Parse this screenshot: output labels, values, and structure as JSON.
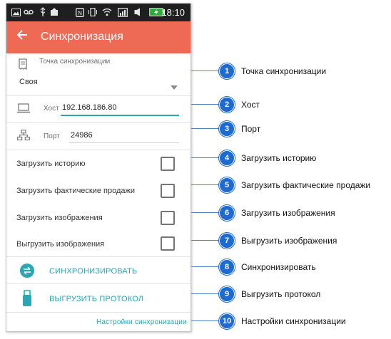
{
  "statusbar": {
    "time": "18:10",
    "icons": [
      "image-icon",
      "voicemail-icon",
      "usb-icon",
      "upload-icon",
      "nfc-icon",
      "vibrate-icon",
      "wifi-icon",
      "signal-icon",
      "battery-icon"
    ]
  },
  "appbar": {
    "back_icon": "arrow-left-icon",
    "title": "Синхронизация"
  },
  "sync_point": {
    "label": "Точка синхронизации",
    "value": "Своя"
  },
  "host": {
    "label": "Хост",
    "value": "192.168.186.80"
  },
  "port": {
    "label": "Порт",
    "value": "24986"
  },
  "checkboxes": [
    {
      "label": "Загрузить историю",
      "checked": false
    },
    {
      "label": "Загрузить фактические продажи",
      "checked": false
    },
    {
      "label": "Загрузить изображения",
      "checked": false
    },
    {
      "label": "Выгрузить изображения",
      "checked": false
    }
  ],
  "actions": {
    "sync": "СИНХРОНИЗИРОВАТЬ",
    "upload_protocol": "ВЫГРУЗИТЬ ПРОТОКОЛ",
    "settings_link": "Настройки синхронизации"
  },
  "colors": {
    "appbar": "#ee6a55",
    "accent": "#2aa6b4",
    "callout": "#1d6bd0"
  },
  "callouts": [
    {
      "num": "1",
      "text": "Точка синхронизации"
    },
    {
      "num": "2",
      "text": "Хост"
    },
    {
      "num": "3",
      "text": "Порт"
    },
    {
      "num": "4",
      "text": "Загрузить историю"
    },
    {
      "num": "5",
      "text": "Загрузить фактические продажи"
    },
    {
      "num": "6",
      "text": "Загрузить изображения"
    },
    {
      "num": "7",
      "text": "Выгрузить изображения"
    },
    {
      "num": "8",
      "text": "Синхронизировать"
    },
    {
      "num": "9",
      "text": "Выгрузить протокол"
    },
    {
      "num": "10",
      "text": "Настройки синхронизации"
    }
  ]
}
